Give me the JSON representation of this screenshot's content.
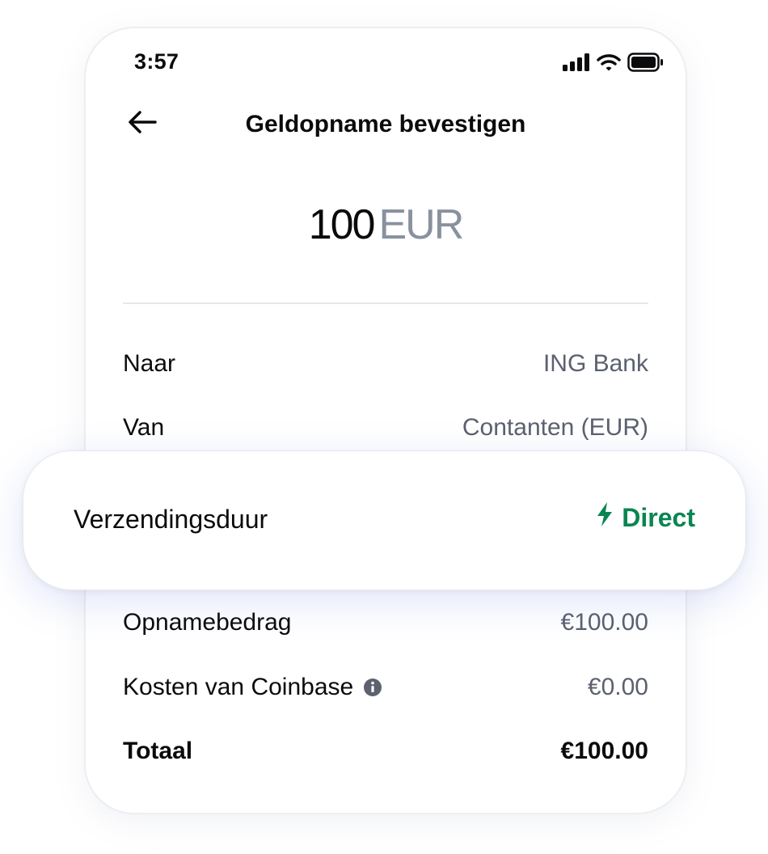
{
  "status_bar": {
    "time": "3:57",
    "icons": [
      "cellular-signal-icon",
      "wifi-icon",
      "battery-icon"
    ]
  },
  "header": {
    "back_icon": "arrow-left-icon",
    "title": "Geldopname bevestigen"
  },
  "amount": {
    "value": "100",
    "currency": "EUR"
  },
  "details": {
    "to": {
      "label": "Naar",
      "value": "ING Bank"
    },
    "from": {
      "label": "Van",
      "value": "Contanten (EUR)"
    },
    "withdrawal_amount": {
      "label": "Opnamebedrag",
      "value": "€100.00"
    },
    "fees": {
      "label": "Kosten van Coinbase",
      "value": "€0.00",
      "icon": "info-icon"
    },
    "total": {
      "label": "Totaal",
      "value": "€100.00"
    }
  },
  "highlight": {
    "label": "Verzendingsduur",
    "value": "Direct",
    "icon": "lightning-bolt-icon"
  },
  "colors": {
    "accent_green": "#098551",
    "muted_text": "#5b616e",
    "currency_gray": "#8a919e",
    "primary_text": "#0a0b0d"
  }
}
